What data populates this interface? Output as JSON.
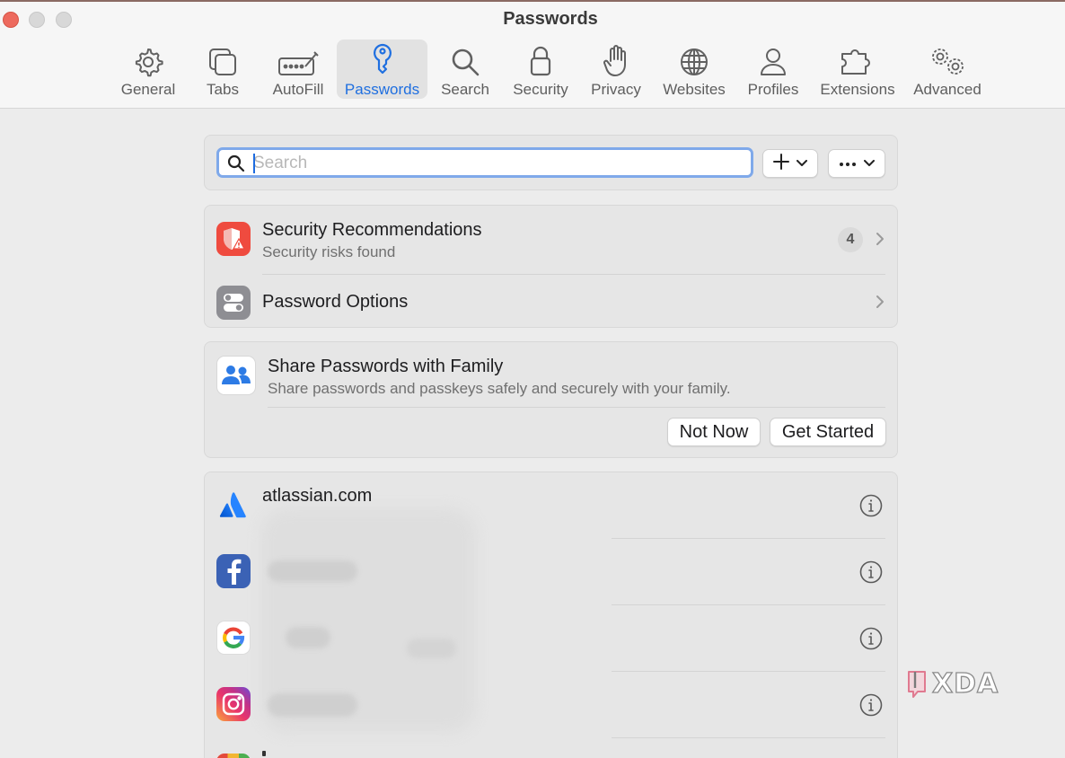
{
  "window": {
    "title": "Passwords"
  },
  "toolbar": {
    "tabs": [
      {
        "label": "General",
        "icon": "gear-icon"
      },
      {
        "label": "Tabs",
        "icon": "tabs-icon"
      },
      {
        "label": "AutoFill",
        "icon": "autofill-icon"
      },
      {
        "label": "Passwords",
        "icon": "key-icon",
        "active": true
      },
      {
        "label": "Search",
        "icon": "search-icon"
      },
      {
        "label": "Security",
        "icon": "lock-icon"
      },
      {
        "label": "Privacy",
        "icon": "hand-icon"
      },
      {
        "label": "Websites",
        "icon": "globe-icon"
      },
      {
        "label": "Profiles",
        "icon": "person-icon"
      },
      {
        "label": "Extensions",
        "icon": "puzzle-icon"
      },
      {
        "label": "Advanced",
        "icon": "gears-icon"
      }
    ]
  },
  "search": {
    "placeholder": "Search",
    "value": ""
  },
  "security": {
    "title": "Security Recommendations",
    "subtitle": "Security risks found",
    "count": "4"
  },
  "options": {
    "title": "Password Options"
  },
  "family": {
    "title": "Share Passwords with Family",
    "subtitle": "Share passwords and passkeys safely and securely with your family.",
    "not_now": "Not Now",
    "get_started": "Get Started"
  },
  "passwords": [
    {
      "site": "atlassian.com",
      "icon": "atlassian-icon"
    },
    {
      "site": "",
      "icon": "facebook-icon"
    },
    {
      "site": "",
      "icon": "google-icon"
    },
    {
      "site": "",
      "icon": "instagram-icon"
    }
  ],
  "watermark": "XDA",
  "colors": {
    "accent": "#1f6fe0",
    "security_red": "#ef4b3f",
    "background": "#ececec"
  }
}
